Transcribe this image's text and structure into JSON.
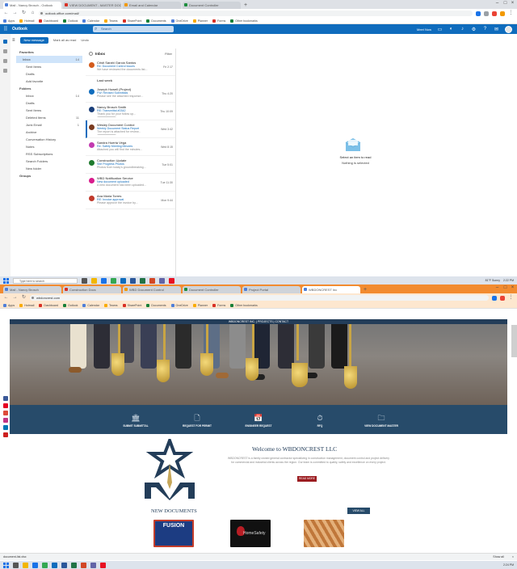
{
  "top": {
    "tabs": [
      {
        "label": "Mail - Nancy Brosch - Outlook"
      },
      {
        "label": "VIEW DOCUMENT - MASTER DOC LIST"
      },
      {
        "label": "Email and Calendar"
      },
      {
        "label": "Document Controller"
      }
    ],
    "address": "outlook.office.com/mail/",
    "bookmarks": [
      "Apps",
      "Hotmail",
      "Dashboard",
      "Outlook",
      "Calendar",
      "Teams",
      "SharePoint",
      "Documents",
      "OneDrive",
      "Planner",
      "Forms",
      "Other bookmarks"
    ],
    "outlook": {
      "brand": "Outlook",
      "search_placeholder": "Search",
      "meet_now": "Meet Now",
      "new_message": "New message",
      "cmd_items": [
        "Mark all as read",
        "Undo"
      ],
      "folders": [
        {
          "label": "Favorites",
          "type": "hdr"
        },
        {
          "label": "Inbox",
          "count": "14",
          "type": "sel"
        },
        {
          "label": "Sent Items",
          "type": "sub"
        },
        {
          "label": "Drafts",
          "type": "sub"
        },
        {
          "label": "Add favorite",
          "type": "sub"
        },
        {
          "label": "Folders",
          "type": "hdr"
        },
        {
          "label": "Inbox",
          "count": "14",
          "type": "sub"
        },
        {
          "label": "Drafts",
          "type": "sub"
        },
        {
          "label": "Sent Items",
          "type": "sub"
        },
        {
          "label": "Deleted Items",
          "count": "11",
          "type": "sub"
        },
        {
          "label": "Junk Email",
          "count": "1",
          "type": "sub"
        },
        {
          "label": "Archive",
          "type": "sub"
        },
        {
          "label": "Conversation History",
          "type": "sub"
        },
        {
          "label": "Notes",
          "type": "sub"
        },
        {
          "label": "RSS Subscriptions",
          "type": "sub"
        },
        {
          "label": "Search Folders",
          "type": "sub"
        },
        {
          "label": "New folder",
          "type": "sub"
        },
        {
          "label": "Groups",
          "type": "hdr"
        }
      ],
      "list_title": "Inbox",
      "list_filter": "Filter",
      "pinned_label": "Last week",
      "messages": [
        {
          "from": "Cristi Sarahi Garcia Santos",
          "subject": "Re: Document Control Issues",
          "preview": "We have reviewed the documents list...",
          "date": "Fri 2:17",
          "avatar_color": "#d35b1c"
        },
        {
          "from": "Joseph Howell (Project)",
          "subject": "FW: Revised Submittals",
          "preview": "Please see the attached response...",
          "date": "Thu 4:20",
          "avatar_color": "#0f6cbd"
        },
        {
          "from": "Nancy Brosch Smith",
          "subject": "RE: Transmittal #0342",
          "preview": "Thank you for your follow up...",
          "date": "Thu 10:09",
          "avatar_color": "#1a3f7a",
          "attach": "drawing.pdf"
        },
        {
          "from": "Wesley Document Control",
          "subject": "Weekly Document Status Report",
          "preview": "The report is attached for review...",
          "date": "Wed 3:42",
          "avatar_color": "#7a3b1f",
          "attach": "Report.xlsx"
        },
        {
          "from": "Sandra Huerta Vega",
          "subject": "Re: Safety Meeting Minutes",
          "preview": "Attached you will find the minutes...",
          "date": "Wed 8:15",
          "avatar_color": "#c23ab0"
        },
        {
          "from": "Construction Update",
          "subject": "Site Progress Photos",
          "preview": "Photos from today's groundbreaking...",
          "date": "Tue 5:01",
          "avatar_color": "#1e7a2e"
        },
        {
          "from": "WBD Notification Service",
          "subject": "New document uploaded",
          "preview": "A new document has been uploaded...",
          "date": "Tue 11:30",
          "avatar_color": "#d81b8c"
        },
        {
          "from": "Ana Maria Torres",
          "subject": "RE: Invoice approval",
          "preview": "Please approve the invoice by...",
          "date": "Mon 9:44",
          "avatar_color": "#c0392b"
        }
      ],
      "reading_title": "Select an item to read",
      "reading_sub": "Nothing is selected"
    },
    "taskbar": {
      "search": "Type here to search",
      "weather": "81°F Sunny",
      "time": "2:22 PM"
    }
  },
  "bottom": {
    "tabs": [
      {
        "label": "Mail - Nancy Brosch"
      },
      {
        "label": "Construction Docs"
      },
      {
        "label": "WBD Document Control"
      },
      {
        "label": "Document Controller"
      },
      {
        "label": "Project Portal"
      },
      {
        "label": "WBDONCREST Inc"
      }
    ],
    "address": "wbdoncrest.com",
    "bookmarks": [
      "Apps",
      "Hotmail",
      "Dashboard",
      "Outlook",
      "Calendar",
      "Teams",
      "SharePoint",
      "Documents",
      "OneDrive",
      "Planner",
      "Forms",
      "Other bookmarks"
    ],
    "site": {
      "topbar": "WBDONCREST INC. | PROJECTS | CONTACT",
      "icons": [
        {
          "label": "SUBMIT SUBMITTAL",
          "icon": "building-icon",
          "glyph": "🏛"
        },
        {
          "label": "REQUEST FOR PERMIT",
          "icon": "document-icon",
          "glyph": "🗋"
        },
        {
          "label": "ENGINEER REQUEST",
          "icon": "calendar-icon",
          "glyph": "📅"
        },
        {
          "label": "RFQ",
          "icon": "clock-icon",
          "glyph": "⏱"
        },
        {
          "label": "VIEW DOCUMENT MASTER",
          "icon": "folder-icon",
          "glyph": "🗀"
        }
      ],
      "welcome_title": "Welcome to WBDONCREST LLC",
      "welcome_text": "WBDONCREST is a family owned general contractor specializing in construction management, document control and project delivery for commercial and industrial clients across the region. Our team is committed to quality, safety and excellence on every project.",
      "welcome_button": "READ MORE",
      "new_docs_title": "NEW DOCUMENTS",
      "view_all": "VIEW ALL",
      "cards": [
        "FUSION",
        "HomeSafety",
        ""
      ]
    },
    "download_item": "document-list.xlsx",
    "show_all": "Show all",
    "taskbar": {
      "search": "Type here to search",
      "time": "2:24 PM"
    }
  }
}
